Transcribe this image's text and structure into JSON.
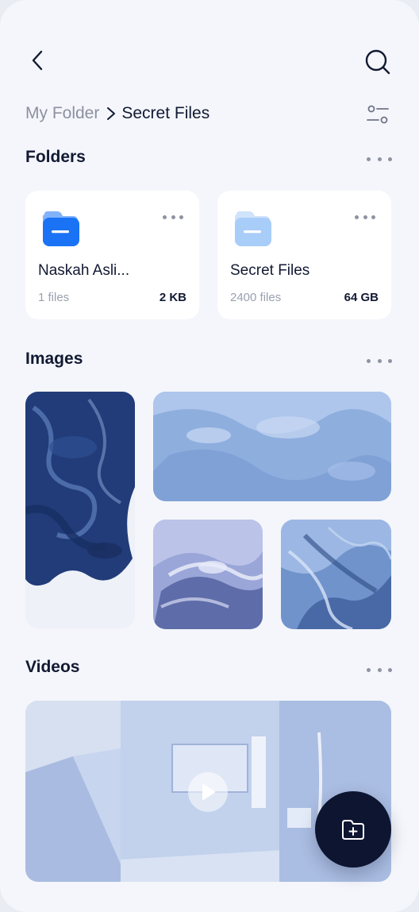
{
  "header": {
    "back_icon": "chevron-left-icon",
    "search_icon": "search-icon"
  },
  "breadcrumb": {
    "root": "My Folder",
    "separator_icon": "chevron-right-icon",
    "current": "Secret Files",
    "filter_icon": "filter-icon"
  },
  "sections": {
    "folders": "Folders",
    "images": "Images",
    "videos": "Videos"
  },
  "folders": [
    {
      "name": "Naskah Asli...",
      "count": "1 files",
      "size": "2 KB",
      "color": "#1a73f5"
    },
    {
      "name": "Secret Files",
      "count": "2400 files",
      "size": "64 GB",
      "color": "#a9cdf9"
    }
  ],
  "video": {
    "play_icon": "play-icon"
  },
  "fab": {
    "icon": "add-folder-icon"
  },
  "colors": {
    "background": "#f4f6fb",
    "text": "#121a33",
    "muted": "#8c90a0",
    "fab": "#0d1530"
  }
}
